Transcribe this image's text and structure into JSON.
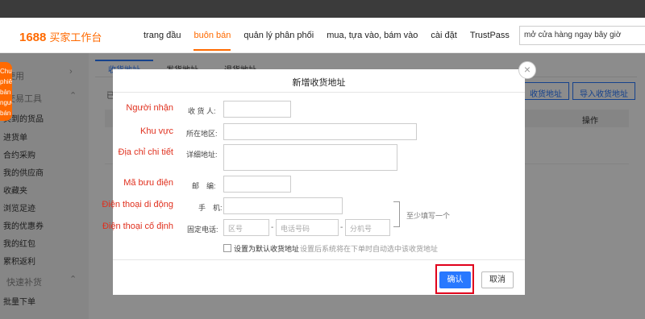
{
  "header": {
    "logo_number": "1688",
    "logo_text": "买家工作台",
    "nav": [
      "trang đầu",
      "buôn bán",
      "quản lý phân phối",
      "mua, tựa vào, bám vào",
      "cài đặt",
      "TrustPass"
    ],
    "active_nav_index": 1,
    "search_value": "mở cửa hàng ngay bây giờ"
  },
  "floating_tab": {
    "label": "Chuyển phiên bản người bán"
  },
  "sidebar": {
    "items": [
      "使用",
      "交易工具",
      "买到的货品",
      "进货单",
      "合约采购",
      "我的供应商",
      "收藏夹",
      "浏览足迹",
      "我的优惠券",
      "我的红包",
      "累积返利",
      "快速补货",
      "批量下单"
    ]
  },
  "content": {
    "tabs": [
      "收货地址",
      "发货地址",
      "退货地址"
    ],
    "cut_label": "已",
    "btn_add": "收货地址",
    "btn_import": "导入收货地址",
    "col_operation": "操作"
  },
  "modal": {
    "title": "新增收货地址",
    "close": "×",
    "rows": {
      "receiver": {
        "vi": "Người nhận",
        "cn": "收 货 人:"
      },
      "region": {
        "vi": "Khu vực",
        "cn": "所在地区:"
      },
      "address": {
        "vi": "Địa chỉ chi tiết",
        "cn": "详细地址:"
      },
      "postcode": {
        "vi": "Mã bưu điện",
        "cn": "邮　编:"
      },
      "mobile": {
        "vi": "Điện thoại di động",
        "cn": "手　机:"
      },
      "phone": {
        "vi": "Điện thoại cố định",
        "cn": "固定电话:"
      }
    },
    "phone_placeholders": {
      "area": "区号",
      "number": "电话号码",
      "ext": "分机号"
    },
    "hint": "至少填写一个",
    "checkbox_label": "设置为默认收货地址",
    "checkbox_note": "设置后系统将在下单时自动选中该收货地址",
    "confirm": "确认",
    "cancel": "取消"
  },
  "colors": {
    "brand": "#ff6a00",
    "primary": "#2878ff",
    "annotation": "#e0301e",
    "highlight_box": "#e0001b"
  }
}
